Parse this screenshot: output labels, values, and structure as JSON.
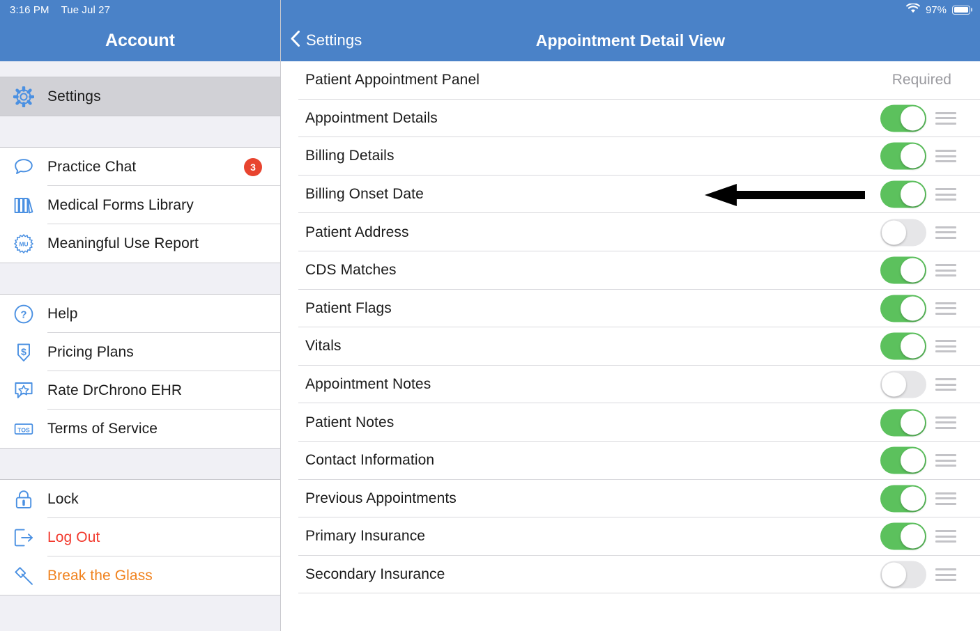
{
  "statusbar": {
    "time": "3:16 PM",
    "date": "Tue Jul 27",
    "battery_percent": "97%",
    "wifi_icon": "wifi-icon",
    "battery_icon": "battery-icon"
  },
  "sidebar": {
    "title": "Account",
    "groups": [
      {
        "items": [
          {
            "label": "Settings",
            "icon": "gear-icon",
            "selected": true,
            "badge": null,
            "color": "default"
          }
        ]
      },
      {
        "items": [
          {
            "label": "Practice Chat",
            "icon": "chat-bubble-icon",
            "selected": false,
            "badge": "3",
            "color": "default"
          },
          {
            "label": "Medical Forms Library",
            "icon": "books-icon",
            "selected": false,
            "badge": null,
            "color": "default"
          },
          {
            "label": "Meaningful Use Report",
            "icon": "mu-seal-icon",
            "selected": false,
            "badge": null,
            "color": "default"
          }
        ]
      },
      {
        "items": [
          {
            "label": "Help",
            "icon": "question-circle-icon",
            "selected": false,
            "badge": null,
            "color": "default"
          },
          {
            "label": "Pricing Plans",
            "icon": "dollar-tag-icon",
            "selected": false,
            "badge": null,
            "color": "default"
          },
          {
            "label": "Rate DrChrono EHR",
            "icon": "star-comment-icon",
            "selected": false,
            "badge": null,
            "color": "default"
          },
          {
            "label": "Terms of Service",
            "icon": "tos-icon",
            "selected": false,
            "badge": null,
            "color": "default"
          }
        ]
      },
      {
        "items": [
          {
            "label": "Lock",
            "icon": "lock-icon",
            "selected": false,
            "badge": null,
            "color": "default"
          },
          {
            "label": "Log Out",
            "icon": "logout-arrow-icon",
            "selected": false,
            "badge": null,
            "color": "red"
          },
          {
            "label": "Break the Glass",
            "icon": "hammer-icon",
            "selected": false,
            "badge": null,
            "color": "orange"
          }
        ]
      }
    ]
  },
  "main": {
    "back_label": "Settings",
    "back_icon": "chevron-left-icon",
    "title": "Appointment Detail View",
    "rows": [
      {
        "label": "Patient Appointment Panel",
        "type": "required",
        "required_text": "Required"
      },
      {
        "label": "Appointment Details",
        "type": "toggle",
        "on": true
      },
      {
        "label": "Billing Details",
        "type": "toggle",
        "on": true
      },
      {
        "label": "Billing Onset Date",
        "type": "toggle",
        "on": true
      },
      {
        "label": "Patient Address",
        "type": "toggle",
        "on": false
      },
      {
        "label": "CDS Matches",
        "type": "toggle",
        "on": true
      },
      {
        "label": "Patient Flags",
        "type": "toggle",
        "on": true
      },
      {
        "label": "Vitals",
        "type": "toggle",
        "on": true
      },
      {
        "label": "Appointment Notes",
        "type": "toggle",
        "on": false
      },
      {
        "label": "Patient Notes",
        "type": "toggle",
        "on": true
      },
      {
        "label": "Contact Information",
        "type": "toggle",
        "on": true
      },
      {
        "label": "Previous Appointments",
        "type": "toggle",
        "on": true
      },
      {
        "label": "Primary Insurance",
        "type": "toggle",
        "on": true
      },
      {
        "label": "Secondary Insurance",
        "type": "toggle",
        "on": false
      }
    ]
  },
  "annotation": {
    "arrow_icon": "left-arrow-annotation",
    "points_at": "Billing Onset Date"
  },
  "colors": {
    "nav_blue": "#4a82c8",
    "toggle_on_green": "#5cc15d",
    "toggle_off_gray": "#e6e6e8",
    "badge_red": "#e8442f",
    "logout_red": "#f23a2e",
    "break_glass_orange": "#f0821e",
    "icon_blue": "#4a90e2",
    "selected_row_gray": "#d1d1d6"
  }
}
